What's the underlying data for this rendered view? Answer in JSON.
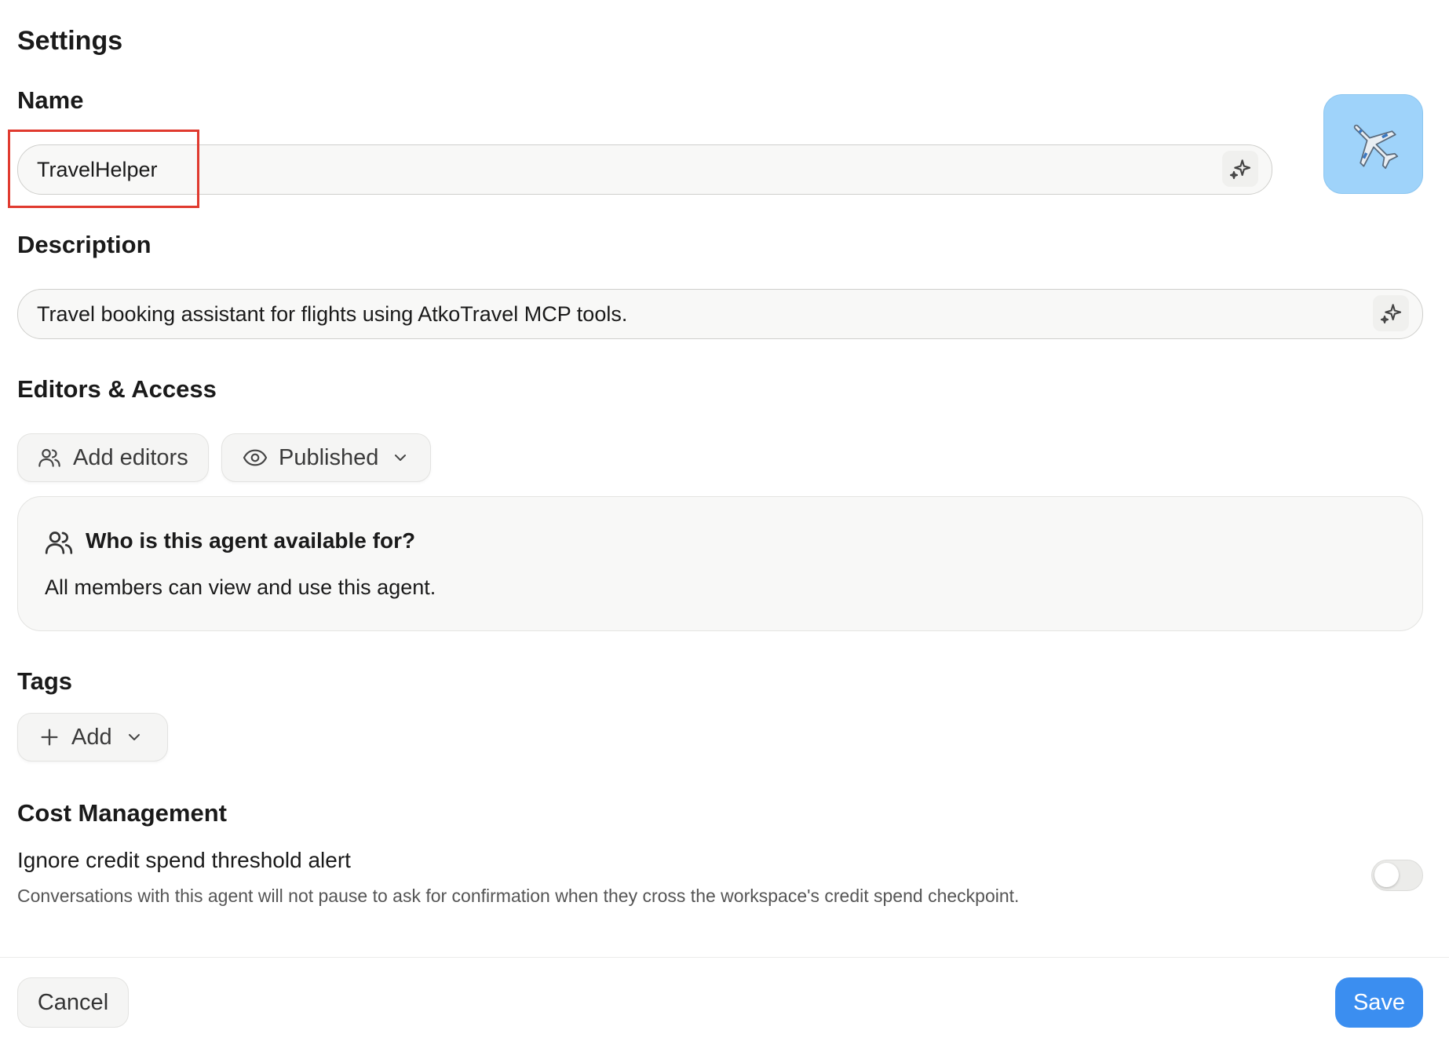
{
  "page": {
    "title": "Settings"
  },
  "name_section": {
    "label": "Name",
    "value": "TravelHelper",
    "generate_icon": "sparkle-icon"
  },
  "avatar": {
    "icon": "airplane-emoji",
    "glyph": "✈️",
    "bg_color": "#9fd3fa"
  },
  "description_section": {
    "label": "Description",
    "value": "Travel booking assistant for flights using AtkoTravel MCP tools.",
    "generate_icon": "sparkle-icon"
  },
  "editors_access": {
    "heading": "Editors & Access",
    "add_editors_label": "Add editors",
    "add_editors_icon": "users-icon",
    "visibility": {
      "selected": "Published",
      "icon": "eye-icon"
    },
    "info_card": {
      "icon": "users-icon",
      "title": "Who is this agent available for?",
      "text": "All members can view and use this agent."
    }
  },
  "tags": {
    "heading": "Tags",
    "add_label": "Add",
    "add_icon": "plus-icon"
  },
  "cost_management": {
    "heading": "Cost Management",
    "setting_title": "Ignore credit spend threshold alert",
    "setting_description": "Conversations with this agent will not pause to ask for confirmation when they cross the workspace's credit spend checkpoint.",
    "toggle_on": false
  },
  "footer": {
    "cancel_label": "Cancel",
    "save_label": "Save"
  },
  "colors": {
    "accent": "#3b8ef0",
    "highlight": "#e03a2f"
  }
}
